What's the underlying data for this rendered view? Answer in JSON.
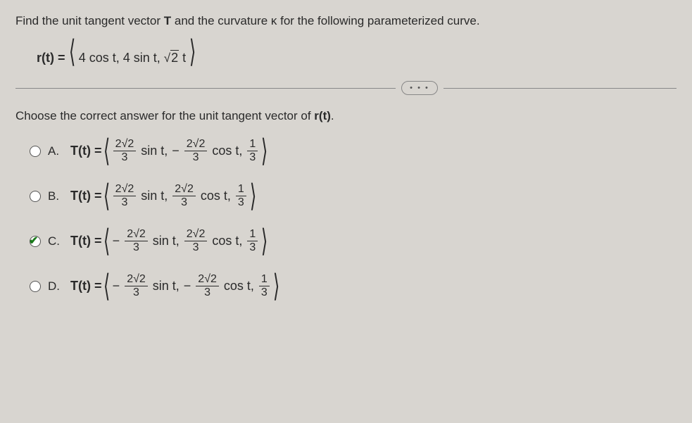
{
  "question": {
    "text_before_T": "Find the unit tangent vector ",
    "T": "T",
    "text_mid": " and the curvature κ for the following parameterized curve.",
    "equation_lhs": "r(t) = ",
    "eq_open": "⟨",
    "eq_t1": "4 cos t,",
    "eq_t2": "4 sin t,",
    "eq_sqrt_val": "2",
    "eq_after_sqrt": " t",
    "eq_close": "⟩"
  },
  "dots": "• • •",
  "sub_prompt_before": "Choose the correct answer for the unit tangent vector of ",
  "sub_prompt_bold": "r(t)",
  "sub_prompt_after": ".",
  "labels": {
    "A": "A.",
    "B": "B.",
    "C": "C.",
    "D": "D."
  },
  "Tt_eq": "T(t) = ",
  "frac_num": "2√2",
  "frac_den": "3",
  "one": "1",
  "sin_t": " sin t,",
  "cos_t": " cos t,",
  "neg": "− ",
  "open_angle": "⟨",
  "close_angle": "⟩"
}
